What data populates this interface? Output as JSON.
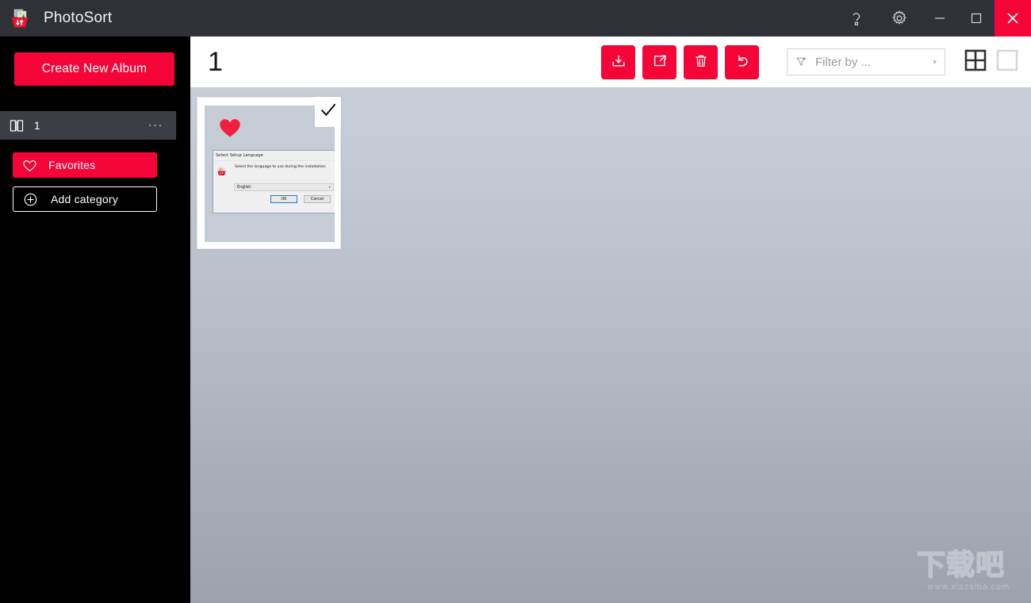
{
  "window": {
    "title": "PhotoSort",
    "app_icon": "photo-sort-basket-icon",
    "controls": {
      "help": "help-icon",
      "settings": "gear-icon",
      "minimize": "minimize-icon",
      "maximize": "maximize-icon",
      "close": "close-icon"
    },
    "accent_color": "#f50537",
    "titlebar_color": "#2f3136"
  },
  "sidebar": {
    "create_album_label": "Create New Album",
    "albums": [
      {
        "icon": "book-icon",
        "label": "1",
        "more": "···",
        "selected": true
      }
    ],
    "categories": [
      {
        "icon": "heart-icon",
        "label": "Favorites",
        "style": "filled"
      },
      {
        "icon": "plus-circle-icon",
        "label": "Add category",
        "style": "outlined"
      }
    ]
  },
  "header": {
    "page_title": "1",
    "tools": [
      {
        "name": "import-button",
        "icon": "box-arrow-down-icon"
      },
      {
        "name": "export-button",
        "icon": "box-arrow-out-icon"
      },
      {
        "name": "delete-button",
        "icon": "trash-icon"
      },
      {
        "name": "undo-button",
        "icon": "undo-arrow-icon"
      }
    ],
    "filter": {
      "icon": "funnel-icon",
      "placeholder": "Filter by ...",
      "value": "",
      "caret": "▾"
    },
    "views": [
      {
        "name": "grid-view-button",
        "icon": "grid-2x2-icon",
        "active": true
      },
      {
        "name": "single-view-button",
        "icon": "square-icon",
        "active": false
      }
    ]
  },
  "content": {
    "background_top": "#c8cfd8",
    "background_bottom": "#9ba2ae",
    "photos": [
      {
        "favorite": true,
        "selected": true,
        "favorite_icon": "heart-filled-icon",
        "check_icon": "checkmark-icon",
        "preview": {
          "type": "windows-dialog",
          "dialog_title": "Select Setup Language",
          "close_glyph": "✕",
          "message": "Select the language to use during the installation:",
          "select_value": "English",
          "select_caret": "∨",
          "ok_label": "OK",
          "cancel_label": "Cancel",
          "icon": "setup-basket-icon"
        }
      }
    ]
  },
  "watermark": {
    "text": "下载吧",
    "url": "www.xiazaiba.com"
  }
}
